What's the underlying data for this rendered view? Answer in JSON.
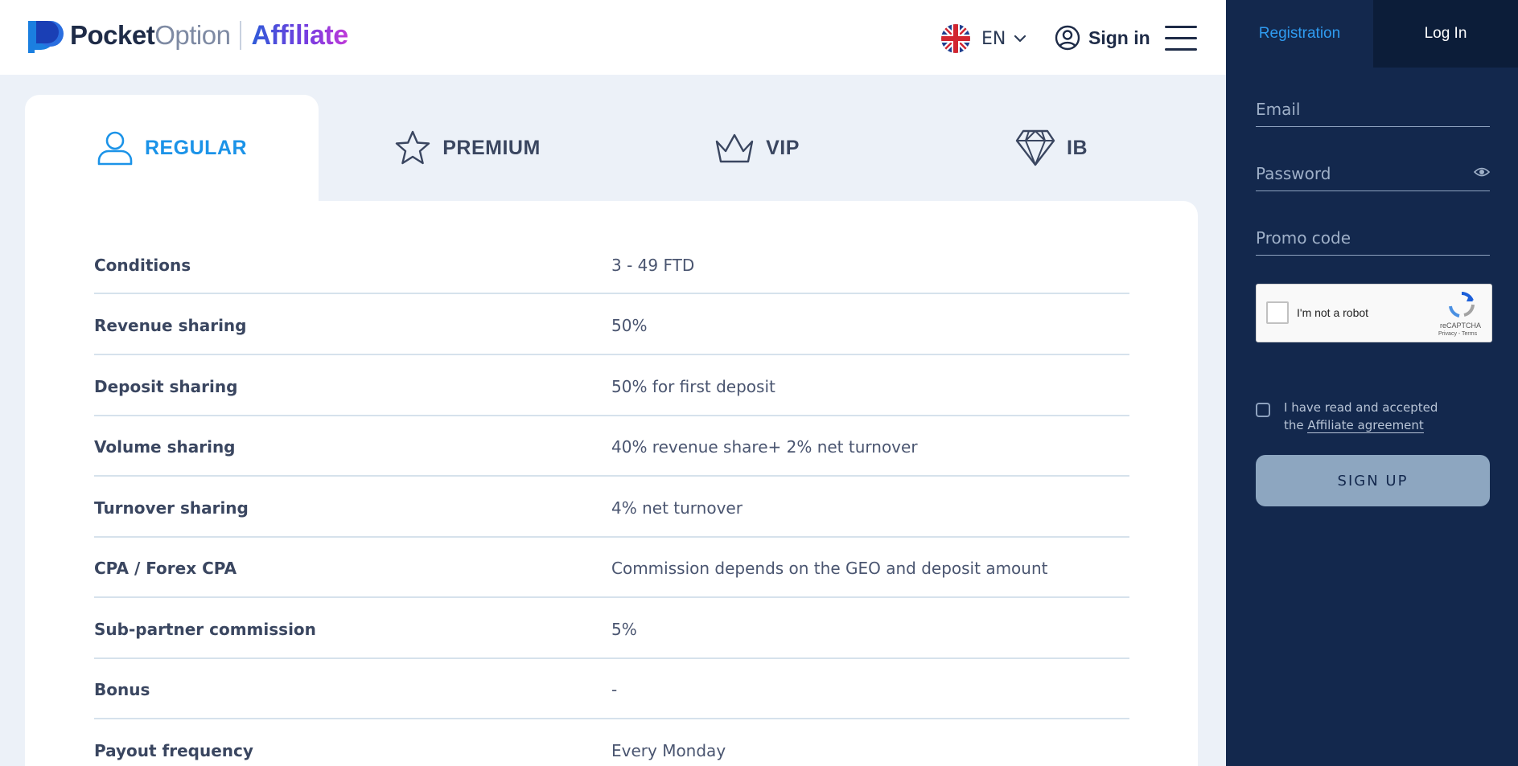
{
  "header": {
    "logo": {
      "brand_bold": "Pocket",
      "brand_light": "Option",
      "affiliate": "Affiliate"
    },
    "language": {
      "code": "EN",
      "icon": "uk-flag-icon"
    },
    "signin_label": "Sign in"
  },
  "tabs": [
    {
      "label": "REGULAR",
      "icon": "user-icon",
      "active": true
    },
    {
      "label": "PREMIUM",
      "icon": "star-icon",
      "active": false
    },
    {
      "label": "VIP",
      "icon": "crown-icon",
      "active": false
    },
    {
      "label": "IB",
      "icon": "diamond-icon",
      "active": false
    }
  ],
  "conditions": [
    {
      "label": "Conditions",
      "value": "3 - 49 FTD"
    },
    {
      "label": "Revenue sharing",
      "value": "50%"
    },
    {
      "label": "Deposit sharing",
      "value": "50% for first deposit"
    },
    {
      "label": "Volume sharing",
      "value": "40% revenue share+ 2% net turnover"
    },
    {
      "label": "Turnover sharing",
      "value": "4% net turnover"
    },
    {
      "label": "CPA / Forex CPA",
      "value": "Commission depends on the GEO and deposit amount"
    },
    {
      "label": "Sub-partner commission",
      "value": "5%"
    },
    {
      "label": "Bonus",
      "value": "-"
    },
    {
      "label": "Payout frequency",
      "value": "Every Monday"
    }
  ],
  "sidebar": {
    "tabs": {
      "registration": "Registration",
      "login": "Log In"
    },
    "fields": {
      "email_placeholder": "Email",
      "password_placeholder": "Password",
      "promo_placeholder": "Promo code"
    },
    "captcha": {
      "label": "I'm not a robot",
      "brand": "reCAPTCHA",
      "links": "Privacy - Terms"
    },
    "agreement": {
      "text_before": "I have read and accepted the ",
      "link": "Affiliate agreement"
    },
    "signup_label": "SIGN UP"
  },
  "colors": {
    "accent": "#1b93e8",
    "sidebar_bg": "#13284d",
    "page_bg": "#ecf1f8",
    "signup_bg": "#8da6c0"
  }
}
